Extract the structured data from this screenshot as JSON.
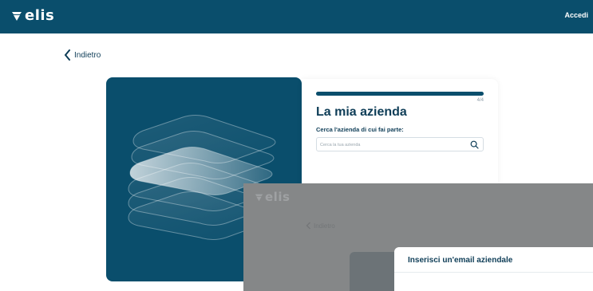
{
  "header": {
    "logo_text": "elis",
    "login_label": "Accedi"
  },
  "back": {
    "label": "Indietro"
  },
  "card": {
    "progress_fraction": 1.0,
    "step_counter": "4/4",
    "title": "La mia azienda",
    "search_label": "Cerca l'azienda di cui fai parte:",
    "search_placeholder": "Cerca la tua azienda",
    "search_icon": "search-icon"
  },
  "overlay": {
    "logo_text": "elis",
    "back_label": "Indietro",
    "modal_title": "Inserisci un'email aziendale"
  },
  "colors": {
    "brand": "#0a4e6c",
    "text": "#0e3d57",
    "overlay": "#858788"
  }
}
